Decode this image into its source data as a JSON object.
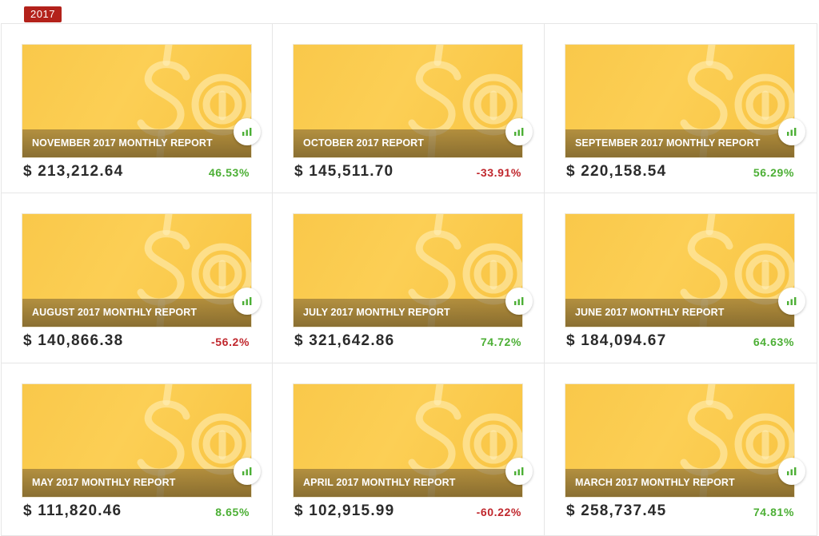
{
  "year_label": "2017",
  "colors": {
    "positive": "#4caf35",
    "negative": "#c0272d",
    "badge": "#b3221b",
    "card": "#fccf55"
  },
  "reports": [
    {
      "title": "NOVEMBER 2017 MONTHLY REPORT",
      "amount": "$ 213,212.64",
      "change": "46.53%",
      "trend": "positive",
      "icon": "bar-chart-icon"
    },
    {
      "title": "OCTOBER 2017 REPORT",
      "amount": "$ 145,511.70",
      "change": "-33.91%",
      "trend": "negative",
      "icon": "bar-chart-icon"
    },
    {
      "title": "SEPTEMBER 2017 MONTHLY REPORT",
      "amount": "$ 220,158.54",
      "change": "56.29%",
      "trend": "positive",
      "icon": "bar-chart-icon"
    },
    {
      "title": "AUGUST 2017 MONTHLY REPORT",
      "amount": "$ 140,866.38",
      "change": "-56.2%",
      "trend": "negative",
      "icon": "bar-chart-icon"
    },
    {
      "title": "JULY 2017 MONTHLY REPORT",
      "amount": "$ 321,642.86",
      "change": "74.72%",
      "trend": "positive",
      "icon": "bar-chart-icon"
    },
    {
      "title": "JUNE 2017 MONTHLY REPORT",
      "amount": "$ 184,094.67",
      "change": "64.63%",
      "trend": "positive",
      "icon": "bar-chart-icon"
    },
    {
      "title": "MAY 2017 MONTHLY REPORT",
      "amount": "$ 111,820.46",
      "change": "8.65%",
      "trend": "positive",
      "icon": "bar-chart-icon"
    },
    {
      "title": "APRIL 2017 MONTHLY REPORT",
      "amount": "$ 102,915.99",
      "change": "-60.22%",
      "trend": "negative",
      "icon": "bar-chart-icon"
    },
    {
      "title": "MARCH 2017 MONTHLY REPORT",
      "amount": "$ 258,737.45",
      "change": "74.81%",
      "trend": "positive",
      "icon": "bar-chart-icon"
    }
  ]
}
